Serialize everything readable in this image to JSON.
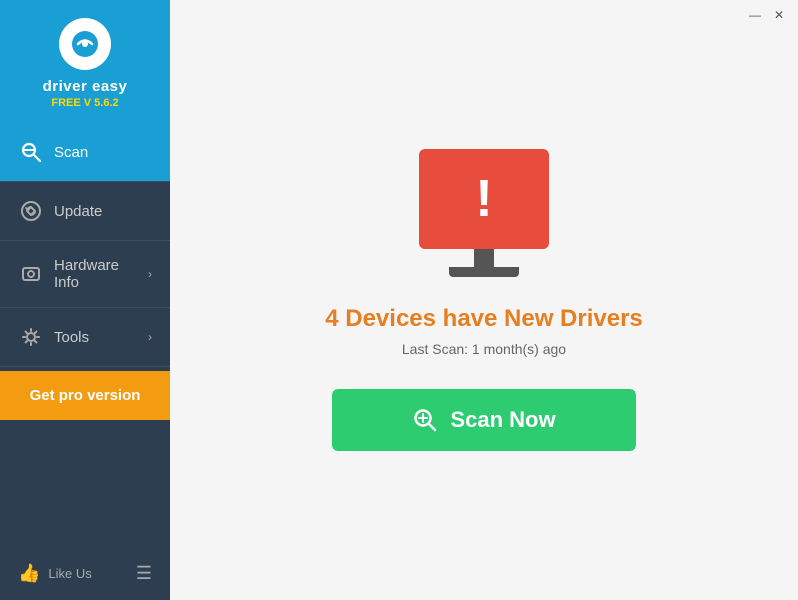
{
  "titlebar": {
    "minimize_label": "—",
    "close_label": "✕"
  },
  "sidebar": {
    "logo": {
      "text": "driver easy",
      "version": "FREE V 5.6.2"
    },
    "nav": [
      {
        "id": "scan",
        "label": "Scan",
        "active": true,
        "has_chevron": false
      },
      {
        "id": "update",
        "label": "Update",
        "active": false,
        "has_chevron": false
      },
      {
        "id": "hardware-info",
        "label": "Hardware Info",
        "active": false,
        "has_chevron": true
      },
      {
        "id": "tools",
        "label": "Tools",
        "active": false,
        "has_chevron": true
      }
    ],
    "get_pro": "Get pro version",
    "footer": {
      "like_us": "Like Us"
    }
  },
  "main": {
    "heading": "4 Devices have New Drivers",
    "last_scan": "Last Scan: 1 month(s) ago",
    "scan_button_label": "Scan Now"
  }
}
